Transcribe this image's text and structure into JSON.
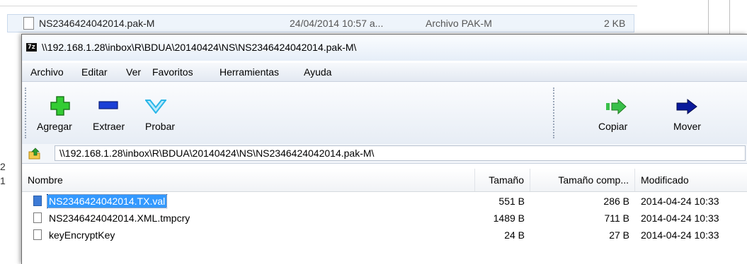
{
  "background": {
    "file_row": {
      "name": "NS2346424042014.pak-M",
      "date": "24/04/2014 10:57 a...",
      "type": "Archivo PAK-M",
      "size": "2 KB"
    },
    "left_fragments": [
      "2",
      "1"
    ]
  },
  "window": {
    "title": "\\\\192.168.1.28\\inbox\\R\\BDUA\\20140424\\NS\\NS2346424042014.pak-M\\",
    "icon_text": "7z"
  },
  "menu": [
    "Archivo",
    "Editar",
    "Ver",
    "Favoritos",
    "Herramientas",
    "Ayuda"
  ],
  "toolbar": {
    "add": "Agregar",
    "extract": "Extraer",
    "test": "Probar",
    "copy": "Copiar",
    "move": "Mover"
  },
  "address": {
    "value": "\\\\192.168.1.28\\inbox\\R\\BDUA\\20140424\\NS\\NS2346424042014.pak-M\\"
  },
  "table": {
    "columns": [
      "Nombre",
      "Tamaño",
      "Tamaño comp...",
      "Modificado"
    ],
    "rows": [
      {
        "name": "NS2346424042014.TX.val",
        "size": "551 B",
        "packed": "286 B",
        "modified": "2014-04-24 10:33",
        "selected": true
      },
      {
        "name": "NS2346424042014.XML.tmpcry",
        "size": "1489 B",
        "packed": "711 B",
        "modified": "2014-04-24 10:33",
        "selected": false
      },
      {
        "name": "keyEncryptKey",
        "size": "24 B",
        "packed": "27 B",
        "modified": "2014-04-24 10:33",
        "selected": false
      }
    ]
  },
  "colors": {
    "selection": "#3399ff",
    "add_icon": "#33cc33",
    "extract_icon": "#1a3fd6",
    "test_icon": "#29b6e8",
    "arrow_icon": "#0a1a9c"
  }
}
